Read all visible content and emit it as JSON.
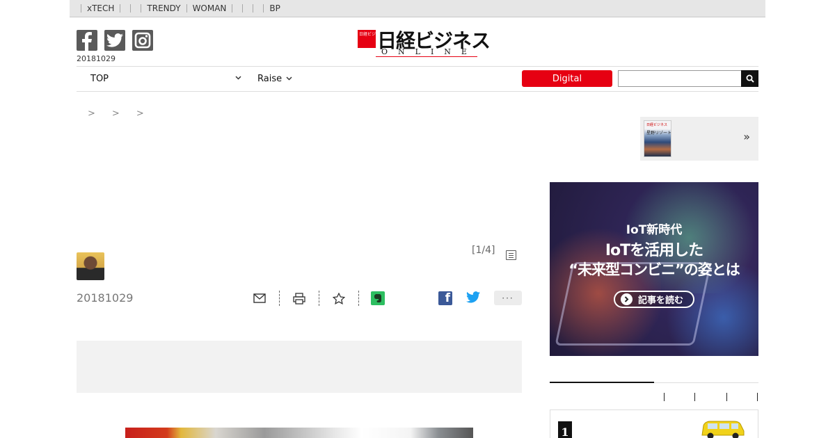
{
  "top_strip": {
    "items": [
      "xTECH",
      "TRENDY",
      "WOMAN",
      "BP"
    ]
  },
  "header": {
    "date": "20181029",
    "logo": {
      "main": "日経ビジネス",
      "sub": "ONLINE",
      "badge": "日経ビジネス"
    }
  },
  "nav": {
    "top_label": "TOP",
    "raise_label": "Raise",
    "digital_label": "Digital",
    "search_placeholder": ""
  },
  "breadcrumb": {
    "separators": [
      ">",
      ">",
      ">"
    ]
  },
  "promo": {
    "cover_title": "日経ビジネス",
    "cover_headline": "星野リゾート",
    "arrow": "»"
  },
  "article": {
    "page_indicator": "[1/4]",
    "date": "20181029",
    "more_label": "···"
  },
  "banner": {
    "line1": "IoT新時代",
    "line2": "IoTを活用した",
    "line3": "“未来型コンビニ”の姿とは",
    "button_label": "記事を読む"
  },
  "ranking": {
    "first_rank": "1"
  },
  "colors": {
    "brand_red": "#e60012",
    "facebook": "#3b5998",
    "twitter": "#1da1f2",
    "evernote": "#2dbe60"
  }
}
